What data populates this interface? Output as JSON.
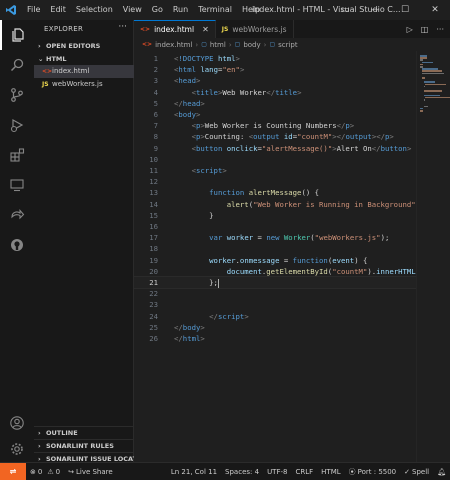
{
  "titlebar": {
    "menu": [
      "File",
      "Edit",
      "Selection",
      "View",
      "Go",
      "Run",
      "Terminal",
      "Help"
    ],
    "title": "index.html - HTML - Visual Studio C..."
  },
  "sidebar": {
    "title": "EXPLORER",
    "open_editors": "OPEN EDITORS",
    "folder": "HTML",
    "files": [
      {
        "name": "index.html",
        "type": "html",
        "selected": true
      },
      {
        "name": "webWorkers.js",
        "type": "js",
        "selected": false
      }
    ],
    "bottom_sections": [
      "OUTLINE",
      "SONARLINT RULES",
      "SONARLINT ISSUE LOCATI..."
    ]
  },
  "tabs": [
    {
      "label": "index.html",
      "type": "html",
      "active": true
    },
    {
      "label": "webWorkers.js",
      "type": "js",
      "active": false
    }
  ],
  "breadcrumb": [
    "index.html",
    "html",
    "body",
    "script"
  ],
  "code_lines": [
    {
      "n": "1",
      "html": "<span class=\"brk\">&lt;</span><span class=\"tag\">!DOCTYPE</span> <span class=\"attr\">html</span><span class=\"brk\">&gt;</span>"
    },
    {
      "n": "2",
      "html": "<span class=\"brk\">&lt;</span><span class=\"tag\">html</span> <span class=\"attr\">lang</span><span class=\"txt\">=</span><span class=\"str\">\"en\"</span><span class=\"brk\">&gt;</span>"
    },
    {
      "n": "3",
      "html": "<span class=\"brk\">&lt;</span><span class=\"tag\">head</span><span class=\"brk\">&gt;</span>"
    },
    {
      "n": "4",
      "html": "    <span class=\"brk\">&lt;</span><span class=\"tag\">title</span><span class=\"brk\">&gt;</span><span class=\"txt\">Web Worker</span><span class=\"brk\">&lt;/</span><span class=\"tag\">title</span><span class=\"brk\">&gt;</span>"
    },
    {
      "n": "5",
      "html": "<span class=\"brk\">&lt;/</span><span class=\"tag\">head</span><span class=\"brk\">&gt;</span>"
    },
    {
      "n": "6",
      "html": "<span class=\"brk\">&lt;</span><span class=\"tag\">body</span><span class=\"brk\">&gt;</span>"
    },
    {
      "n": "7",
      "html": "    <span class=\"brk\">&lt;</span><span class=\"tag\">p</span><span class=\"brk\">&gt;</span><span class=\"txt\">Web Worker is Counting Numbers</span><span class=\"brk\">&lt;/</span><span class=\"tag\">p</span><span class=\"brk\">&gt;</span>"
    },
    {
      "n": "8",
      "html": "    <span class=\"brk\">&lt;</span><span class=\"tag\">p</span><span class=\"brk\">&gt;</span><span class=\"txt\">Counting: </span><span class=\"brk\">&lt;</span><span class=\"tag\">output</span> <span class=\"attr\">id</span><span class=\"txt\">=</span><span class=\"str\">\"countM\"</span><span class=\"brk\">&gt;&lt;/</span><span class=\"tag\">output</span><span class=\"brk\">&gt;&lt;/</span><span class=\"tag\">p</span><span class=\"brk\">&gt;</span>"
    },
    {
      "n": "9",
      "html": "    <span class=\"brk\">&lt;</span><span class=\"tag\">button</span> <span class=\"attr\">onclick</span><span class=\"txt\">=</span><span class=\"str\">\"alertMessage()\"</span><span class=\"brk\">&gt;</span><span class=\"txt\">Alert On</span><span class=\"brk\">&lt;/</span><span class=\"tag\">button</span><span class=\"brk\">&gt;</span>"
    },
    {
      "n": "10",
      "html": ""
    },
    {
      "n": "11",
      "html": "    <span class=\"brk\">&lt;</span><span class=\"tag\">script</span><span class=\"brk\">&gt;</span>"
    },
    {
      "n": "12",
      "html": ""
    },
    {
      "n": "13",
      "html": "        <span class=\"kw\">function</span> <span class=\"fn\">alertMessage</span><span class=\"txt\">() {</span>"
    },
    {
      "n": "14",
      "html": "            <span class=\"fn\">alert</span><span class=\"txt\">(</span><span class=\"str\">\"Web Worker is Running in Background\"</span><span class=\"txt\">);</span>"
    },
    {
      "n": "15",
      "html": "        <span class=\"txt\">}</span>"
    },
    {
      "n": "16",
      "html": ""
    },
    {
      "n": "17",
      "html": "        <span class=\"kw\">var</span> <span class=\"var\">worker</span> <span class=\"txt\">= </span><span class=\"kw\">new</span> <span class=\"cls\">Worker</span><span class=\"txt\">(</span><span class=\"str\">\"webWorkers.js\"</span><span class=\"txt\">);</span>"
    },
    {
      "n": "18",
      "html": ""
    },
    {
      "n": "19",
      "html": "        <span class=\"var\">worker</span><span class=\"txt\">.</span><span class=\"var\">onmessage</span> <span class=\"txt\">= </span><span class=\"kw\">function</span><span class=\"txt\">(</span><span class=\"var\">event</span><span class=\"txt\">) {</span>"
    },
    {
      "n": "20",
      "html": "            <span class=\"var\">document</span><span class=\"txt\">.</span><span class=\"fn\">getElementById</span><span class=\"txt\">(</span><span class=\"str\">\"countM\"</span><span class=\"txt\">).</span><span class=\"var\">innerHTML</span><span class=\"txt\"> = event.data;</span>"
    },
    {
      "n": "21",
      "html": "        <span class=\"txt\">};</span><span class=\"cursor\"></span>"
    },
    {
      "n": "22",
      "html": ""
    },
    {
      "n": "23",
      "html": ""
    },
    {
      "n": "24",
      "html": "        <span class=\"brk\">&lt;/</span><span class=\"tag\">script</span><span class=\"brk\">&gt;</span>"
    },
    {
      "n": "25",
      "html": "<span class=\"brk\">&lt;/</span><span class=\"tag\">body</span><span class=\"brk\">&gt;</span>"
    },
    {
      "n": "26",
      "html": "<span class=\"brk\">&lt;/</span><span class=\"tag\">html</span><span class=\"brk\">&gt;</span>"
    }
  ],
  "current_line": "21",
  "statusbar": {
    "errors": "0",
    "warnings": "0",
    "live_share": "Live Share",
    "position": "Ln 21, Col 11",
    "spaces": "Spaces: 4",
    "encoding": "UTF-8",
    "eol": "CRLF",
    "language": "HTML",
    "port": "Port : 5500",
    "spell": "Spell"
  },
  "colors": {
    "accent": "#0078d4",
    "remote": "#f26522"
  }
}
